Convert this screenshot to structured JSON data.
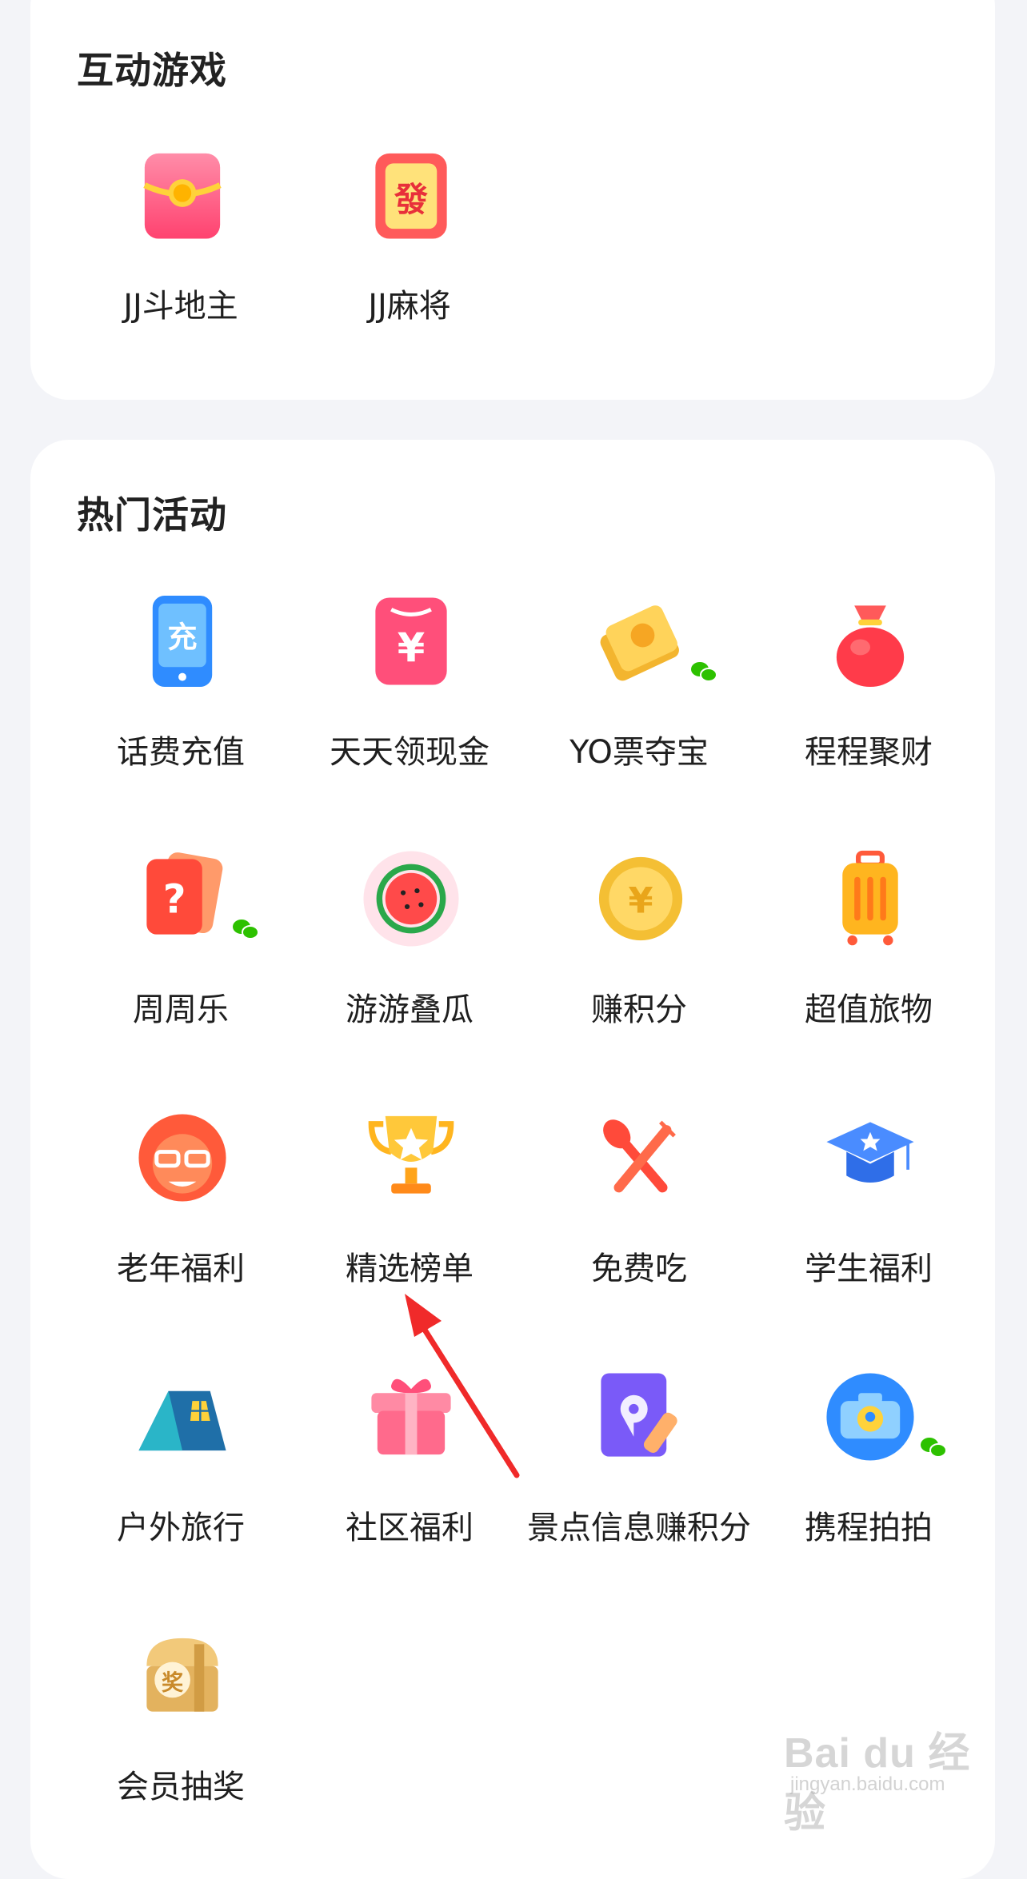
{
  "sections": {
    "games": {
      "title": "互动游戏",
      "items": [
        {
          "label": "JJ斗地主",
          "icon": "red-envelope-coin-icon"
        },
        {
          "label": "JJ麻将",
          "icon": "mahjong-fa-tile-icon"
        }
      ]
    },
    "hot": {
      "title": "热门活动",
      "items": [
        {
          "label": "话费充值",
          "icon": "phone-recharge-icon"
        },
        {
          "label": "天天领现金",
          "icon": "cash-envelope-icon"
        },
        {
          "label": "YO票夺宝",
          "icon": "yo-ticket-icon",
          "badge": "wechat-badge-icon"
        },
        {
          "label": "程程聚财",
          "icon": "money-bag-icon"
        },
        {
          "label": "周周乐",
          "icon": "mystery-card-icon",
          "badge": "wechat-badge-icon"
        },
        {
          "label": "游游叠瓜",
          "icon": "watermelon-icon"
        },
        {
          "label": "赚积分",
          "icon": "gold-coin-icon"
        },
        {
          "label": "超值旅物",
          "icon": "suitcase-icon"
        },
        {
          "label": "老年福利",
          "icon": "elder-face-icon"
        },
        {
          "label": "精选榜单",
          "icon": "trophy-icon"
        },
        {
          "label": "免费吃",
          "icon": "spoon-fork-icon"
        },
        {
          "label": "学生福利",
          "icon": "graduation-cap-icon"
        },
        {
          "label": "户外旅行",
          "icon": "tent-icon"
        },
        {
          "label": "社区福利",
          "icon": "gift-box-icon"
        },
        {
          "label": "景点信息赚积分",
          "icon": "map-pin-pencil-icon"
        },
        {
          "label": "携程拍拍",
          "icon": "camera-pin-icon",
          "badge": "wechat-badge-icon"
        },
        {
          "label": "会员抽奖",
          "icon": "prize-chest-icon"
        }
      ]
    }
  },
  "icon_texts": {
    "recharge": "充",
    "yuan": "¥",
    "fa": "發",
    "prize": "奖",
    "question": "?"
  },
  "watermark": {
    "main": "Bai du 经验",
    "sub": "jingyan.baidu.com"
  },
  "colors": {
    "background": "#f3f4f8",
    "card": "#ffffff",
    "arrow": "#f02a2a"
  }
}
